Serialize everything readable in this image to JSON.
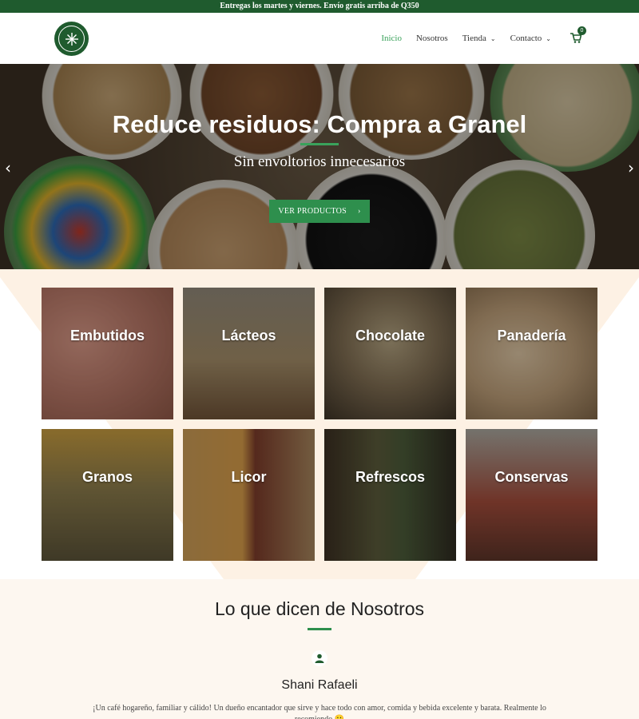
{
  "topbar": {
    "text": "Entregas los martes y viernes. Envío gratis arriba de Q350"
  },
  "header": {
    "logo_alt": "DEL OTRO LADO",
    "nav": [
      {
        "label": "Inicio",
        "active": true,
        "dropdown": false
      },
      {
        "label": "Nosotros",
        "active": false,
        "dropdown": false
      },
      {
        "label": "Tienda",
        "active": false,
        "dropdown": true
      },
      {
        "label": "Contacto",
        "active": false,
        "dropdown": true
      }
    ],
    "cart_count": "0"
  },
  "hero": {
    "title": "Reduce residuos: Compra a Granel",
    "subtitle": "Sin envoltorios innecesarios",
    "button_label": "VER PRODUCTOS",
    "button_icon": "›",
    "prev_icon": "‹",
    "next_icon": "›"
  },
  "categories": [
    {
      "label": "Embutidos",
      "color": "#a86a5c"
    },
    {
      "label": "Lácteos",
      "color": "#8a6f4d"
    },
    {
      "label": "Chocolate",
      "color": "#5a4a3a"
    },
    {
      "label": "Panadería",
      "color": "#9c8267"
    },
    {
      "label": "Granos",
      "color": "#7a6a44"
    },
    {
      "label": "Licor",
      "color": "#a88458"
    },
    {
      "label": "Refrescos",
      "color": "#4a4a36"
    },
    {
      "label": "Conservas",
      "color": "#8c5a48"
    }
  ],
  "testimonials": {
    "title": "Lo que dicen de Nosotros",
    "name": "Shani Rafaeli",
    "quote": "¡Un café hogareño, familiar y cálido! Un dueño encantador que sirve y hace todo con amor, comida y bebida excelente y barata. Realmente lo recomiendo 🙂"
  },
  "colors": {
    "brand_green": "#1f5b2e",
    "accent_green": "#3aa25b",
    "cream": "#fdf7f0"
  }
}
